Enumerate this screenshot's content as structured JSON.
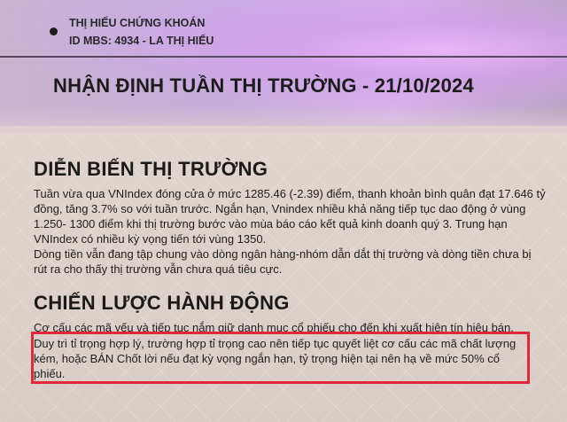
{
  "brand": {
    "company": "THỊ HIẾU CHỨNG KHOÁN",
    "broker_id": "ID MBS: 4934 - LA THỊ HIẾU"
  },
  "report_title": "NHẬN ĐỊNH TUẦN THỊ TRƯỜNG - 21/10/2024",
  "market_section": {
    "title": "DIỄN BIẾN THỊ TRƯỜNG",
    "lines": [
      "Tuần vừa qua VNIndex đóng cửa ở mức 1285.46 (-2.39) điểm, thanh khoản bình quân đạt 17.646 tỷ",
      "đồng, tăng 3.7% so với tuần trước. Ngắn hạn, Vnindex nhiều khả năng tiếp tục dao động ở vùng",
      "1.250- 1300 điểm khi thị trường bước vào mùa báo cáo kết quả kinh doanh quý 3. Trung hạn",
      "VNIndex có nhiều kỳ vọng tiến tới vùng 1350.",
      "Dòng tiền vẫn đang tập chung vào dòng ngân hàng-nhóm dẫn dắt thị trường và dòng tiền chưa bị",
      "rút ra cho thấy thị trường vẫn chưa quá tiêu cực."
    ]
  },
  "strategy_section": {
    "title": "CHIẾN LƯỢC HÀNH ĐỘNG",
    "lines": [
      "Cơ cấu các mã yếu và tiếp tục nắm giữ danh mục cổ phiếu cho đến khi xuất hiện tín hiệu bán.",
      "Duy trì tỉ trọng hợp lý, trường hợp tỉ trọng cao nên tiếp tục quyết liệt cơ cấu các mã chất lượng",
      "kém, hoặc BÁN Chốt lời nếu đạt kỳ vọng ngắn hạn, tỷ trọng hiện tại nên hạ về mức 50% cổ",
      "phiếu."
    ]
  },
  "colors": {
    "highlight_border": "#e0283a",
    "header_accent": "#d9b3ea"
  }
}
